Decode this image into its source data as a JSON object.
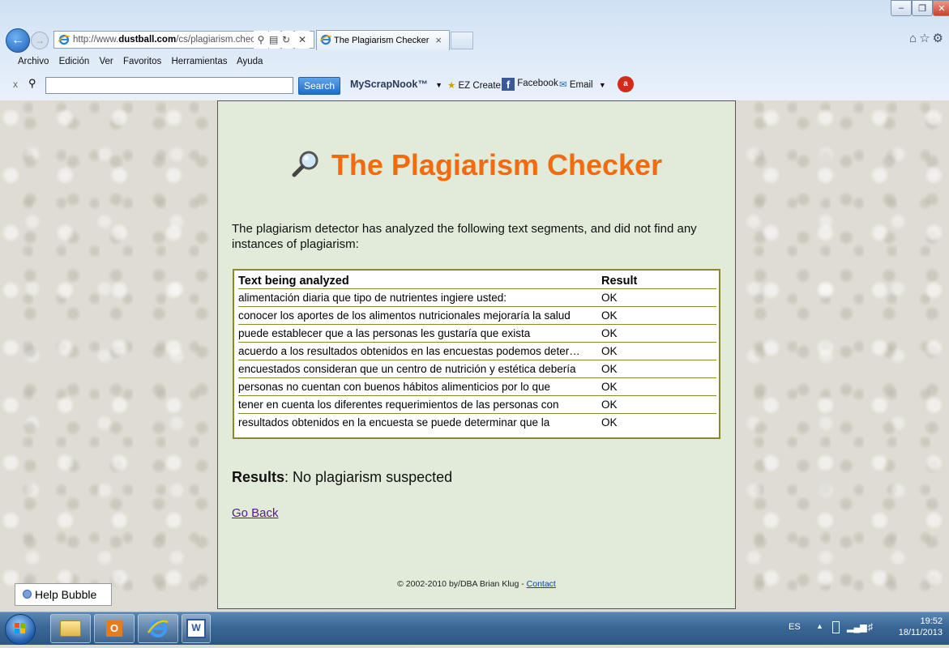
{
  "browser": {
    "address": {
      "prefix": "http://www.",
      "host": "dustball.com",
      "path": "/cs/plagiarism.checker"
    },
    "tab_title": "The Plagiarism Checker",
    "tab_close": "×",
    "menu": [
      "Archivo",
      "Edición",
      "Ver",
      "Favoritos",
      "Herramientas",
      "Ayuda"
    ],
    "toolbar": {
      "search_label": "Search",
      "search_value": "",
      "myscrapnook": "MyScrapNook™",
      "ez_create": "EZ Create",
      "facebook": "Facebook",
      "email": "Email"
    }
  },
  "page": {
    "title": "The Plagiarism Checker",
    "intro": "The plagiarism detector has analyzed the following text segments, and did not find any instances of plagiarism:",
    "table": {
      "headers": [
        "Text being analyzed",
        "Result"
      ],
      "rows": [
        [
          "alimentación diaria que tipo de nutrientes ingiere usted:",
          "OK"
        ],
        [
          "conocer los aportes de los alimentos nutricionales mejoraría la salud",
          "OK"
        ],
        [
          "puede establecer que a las personas les gustaría que exista",
          "OK"
        ],
        [
          "acuerdo a los resultados obtenidos en las encuestas podemos deter…",
          "OK"
        ],
        [
          "encuestados consideran que un centro de nutrición y estética debería",
          "OK"
        ],
        [
          "personas no cuentan con buenos hábitos alimenticios por lo que",
          "OK"
        ],
        [
          "tener en cuenta los diferentes requerimientos de las personas con",
          "OK"
        ],
        [
          "resultados obtenidos en la encuesta se puede determinar que la",
          "OK"
        ]
      ]
    },
    "summary_label": "Results",
    "summary_text": ": No plagiarism suspected",
    "go_back": "Go Back",
    "footer_text": "© 2002-2010 by/DBA Brian Klug - ",
    "footer_link": "Contact"
  },
  "help_bubble": "Help Bubble",
  "taskbar": {
    "language": "ES",
    "time": "19:52",
    "date": "18/11/2013"
  },
  "colors": {
    "title_orange": "#f26b0f",
    "panel_bg": "#e2ebd9",
    "table_border": "#8a8a2a",
    "link_visited": "#551a8b"
  }
}
